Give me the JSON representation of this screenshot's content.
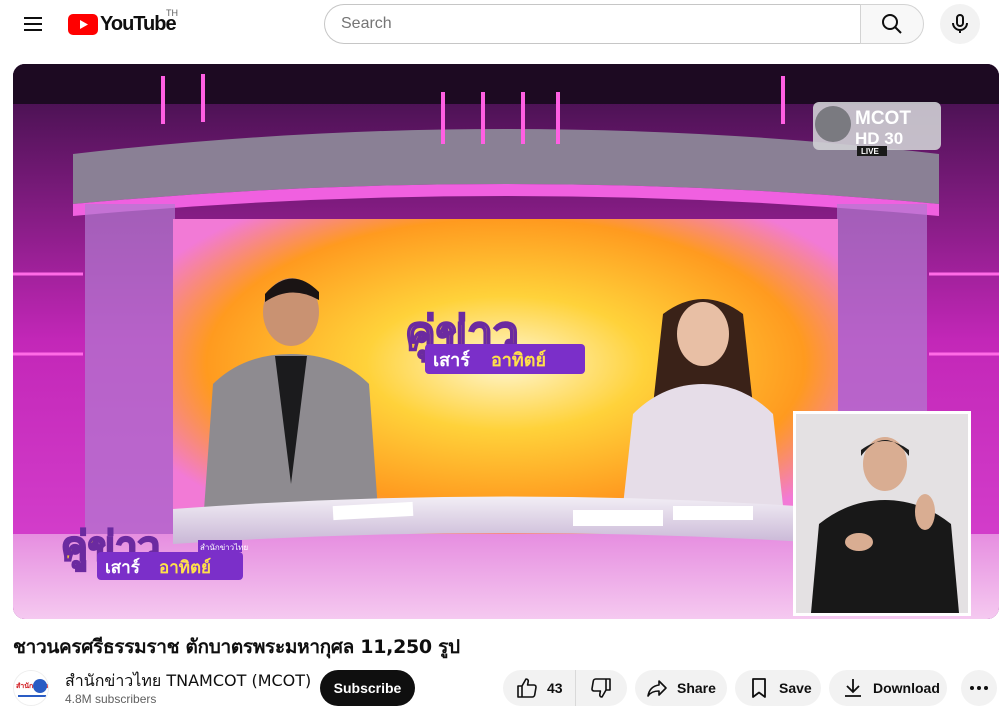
{
  "masthead": {
    "logo_text": "YouTube",
    "country_code": "TH",
    "search_placeholder": "Search"
  },
  "video": {
    "title": "ชาวนครศรีธรรมราช ตักบาตรพระมหากุศล 11,250 รูป",
    "overlay": {
      "program_line1": "คู่ข่าว",
      "program_line2a": "เสาร์",
      "program_line2b": "อาทิตย์",
      "program_badge": "สำนักข่าวไทย",
      "channel_logo_text": "MCOT",
      "channel_logo_sub": "HD 30",
      "live_text": "LIVE"
    }
  },
  "channel": {
    "name": "สำนักข่าวไทย TNAMCOT (MCOT)",
    "subscribers": "4.8M subscribers",
    "avatar_text": "สำนัก ข่าวไทย"
  },
  "actions": {
    "subscribe_label": "Subscribe",
    "like_count": "43",
    "share_label": "Share",
    "save_label": "Save",
    "download_label": "Download"
  },
  "colors": {
    "brand_red": "#ff0000",
    "studio_pink": "#e23ad0",
    "studio_yellow": "#ffc21a",
    "title_purple": "#7b2fc9"
  }
}
